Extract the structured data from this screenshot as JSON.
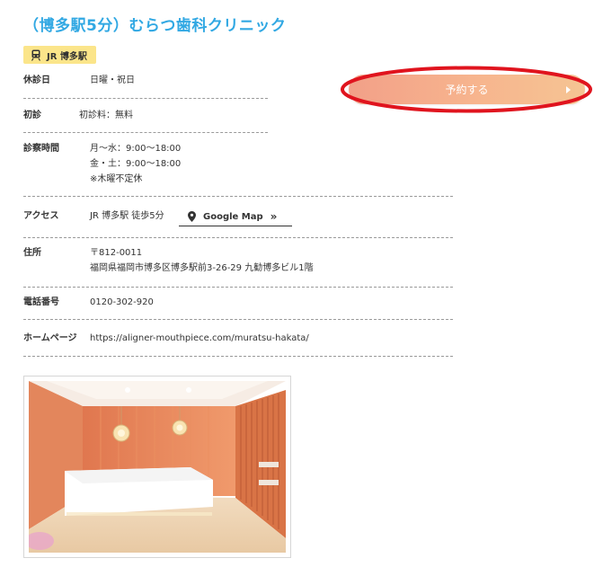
{
  "clinic": {
    "title": "（博多駅5分）むらつ歯科クリニック",
    "station_badge": "JR 博多駅"
  },
  "reserve": {
    "label": "予約する"
  },
  "info": {
    "closed": {
      "label": "休診日",
      "value": "日曜・祝日"
    },
    "first_visit": {
      "label": "初診",
      "value": "初診料：無料"
    },
    "hours": {
      "label": "診察時間",
      "lines": [
        "月～水：9:00～18:00",
        "金・土：9:00～18:00",
        "※木曜不定休"
      ]
    },
    "access": {
      "label": "アクセス",
      "value": "JR 博多駅 徒歩5分",
      "map_link": "Google Map",
      "map_arrow": "»"
    },
    "address": {
      "label": "住所",
      "postal": "〒812-0011",
      "line": "福岡県福岡市博多区博多駅前3-26-29 九勧博多ビル1階"
    },
    "phone": {
      "label": "電話番号",
      "value": "0120-302-920"
    },
    "homepage": {
      "label": "ホームページ",
      "url": "https://aligner-mouthpiece.com/muratsu-hakata/"
    }
  },
  "colors": {
    "title": "#31a8e3",
    "badge": "#fbe58a",
    "button_start": "#f2a088",
    "button_end": "#f5c493",
    "highlight": "#e0141e",
    "link": "#1a56d6"
  }
}
